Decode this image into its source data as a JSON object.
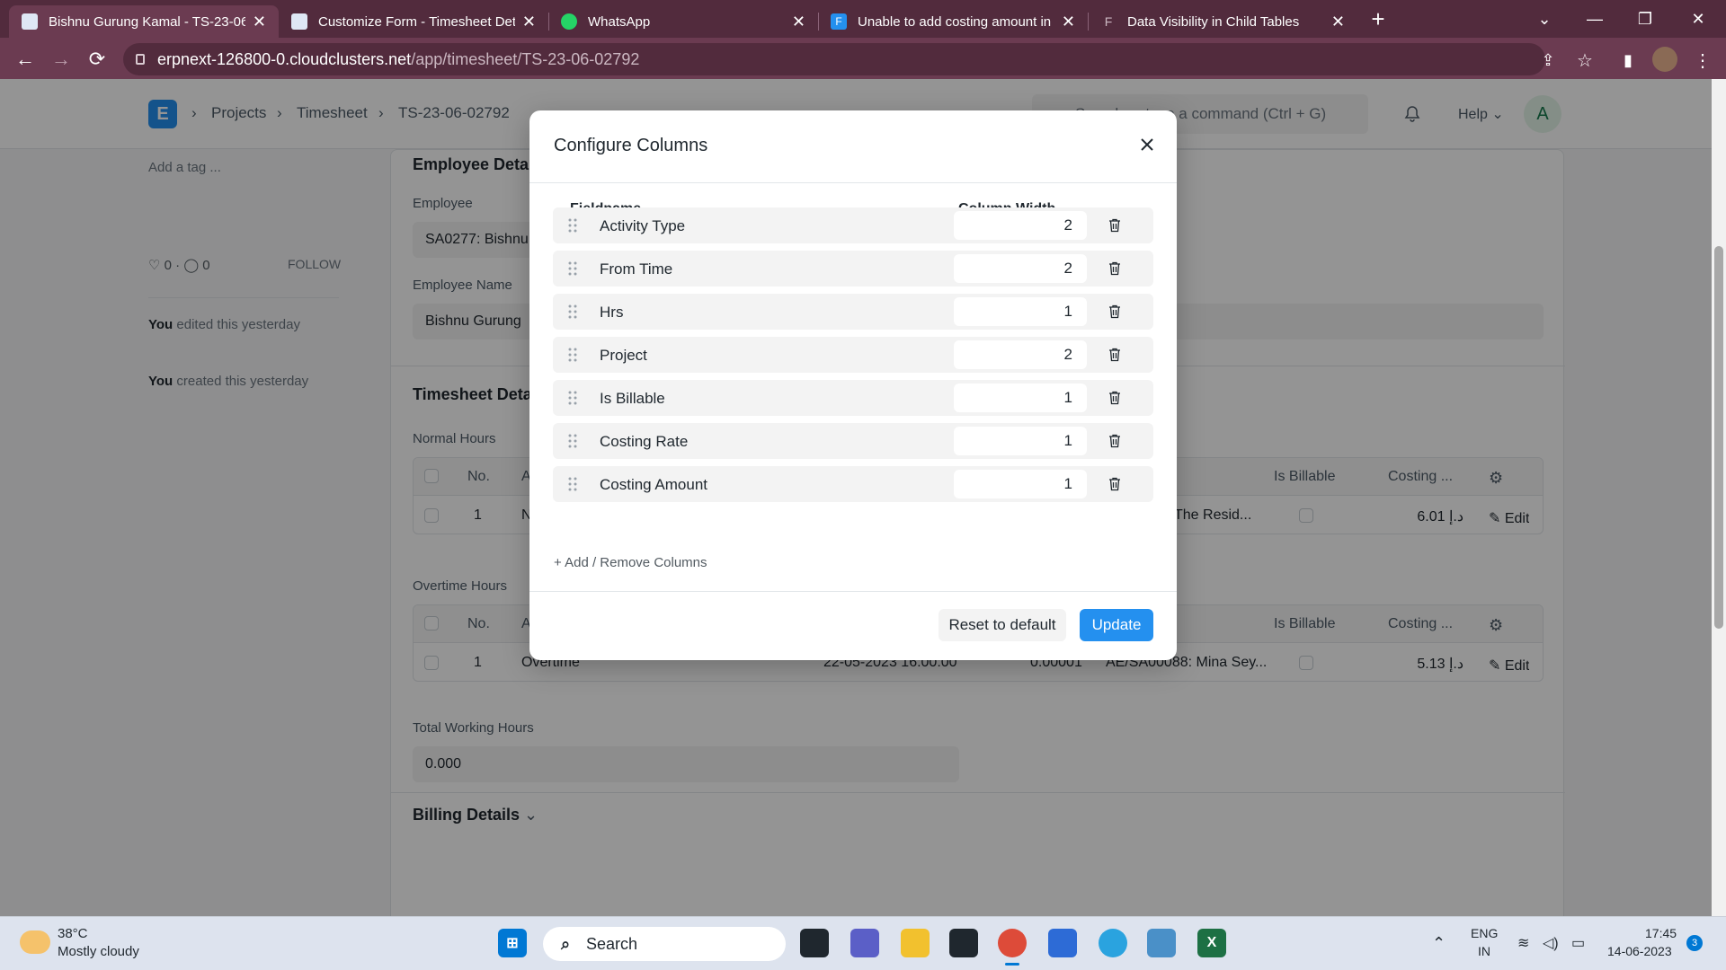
{
  "browser": {
    "tabs": [
      {
        "title": "Bishnu Gurung Kamal - TS-23-06",
        "fav_color": "#2a5caa"
      },
      {
        "title": "Customize Form - Timesheet Det",
        "fav_color": "#2a5caa"
      },
      {
        "title": "WhatsApp",
        "fav_color": "#25d366"
      },
      {
        "title": "Unable to add costing amount in",
        "fav_color": "#2490ef"
      },
      {
        "title": "Data Visibility in Child Tables",
        "fav_color": "#6b3b51"
      }
    ],
    "url_host": "erpnext-126800-0.cloudclusters.net",
    "url_path": "/app/timesheet/TS-23-06-02792"
  },
  "appbar": {
    "logo": "E",
    "breadcrumbs": [
      "Projects",
      "Timesheet",
      "TS-23-06-02792"
    ],
    "search_placeholder": "Search or type a command (Ctrl + G)",
    "help_label": "Help",
    "avatar_letter": "A"
  },
  "sidebar": {
    "add_tag": "Add a tag ...",
    "likes": "0",
    "comments": "0",
    "follow": "FOLLOW",
    "activity": [
      {
        "who": "You",
        "text": "edited this yesterday"
      },
      {
        "who": "You",
        "text": "created this yesterday"
      }
    ]
  },
  "form": {
    "employee_section": "Employee Details",
    "employee_label": "Employee",
    "employee_value": "SA0277: Bishnu",
    "employee_name_label": "Employee Name",
    "employee_name_value": "Bishnu Gurung",
    "timesheet_section": "Timesheet Details",
    "normal_hours_label": "Normal Hours",
    "overtime_hours_label": "Overtime Hours",
    "grid_headers": {
      "no": "No.",
      "activity": "A",
      "is_billable": "Is Billable",
      "costing": "Costing ..."
    },
    "normal_row": {
      "no": "1",
      "activity": "N",
      "project": "The Resid...",
      "costing": "6.01 د.إ",
      "edit": "Edit"
    },
    "overtime_row": {
      "no": "1",
      "activity": "Overtime",
      "from_time": "22-05-2023 16:00:00",
      "hrs": "0.00001",
      "project": "AE/SA00088: Mina Sey...",
      "costing": "5.13 د.إ",
      "edit": "Edit"
    },
    "total_label": "Total Working Hours",
    "total_value": "0.000",
    "billing_section": "Billing Details"
  },
  "modal": {
    "title": "Configure Columns",
    "col_fieldname": "Fieldname",
    "col_width": "Column Width",
    "rows": [
      {
        "field": "Activity Type",
        "width": "2"
      },
      {
        "field": "From Time",
        "width": "2"
      },
      {
        "field": "Hrs",
        "width": "1"
      },
      {
        "field": "Project",
        "width": "2"
      },
      {
        "field": "Is Billable",
        "width": "1"
      },
      {
        "field": "Costing Rate",
        "width": "1"
      },
      {
        "field": "Costing Amount",
        "width": "1"
      }
    ],
    "add_remove": "+ Add / Remove Columns",
    "reset": "Reset to default",
    "update": "Update"
  },
  "taskbar": {
    "temp": "38°C",
    "weather": "Mostly cloudy",
    "search": "Search",
    "lang1": "ENG",
    "lang2": "IN",
    "time": "17:45",
    "date": "14-06-2023",
    "notif_count": "3"
  }
}
